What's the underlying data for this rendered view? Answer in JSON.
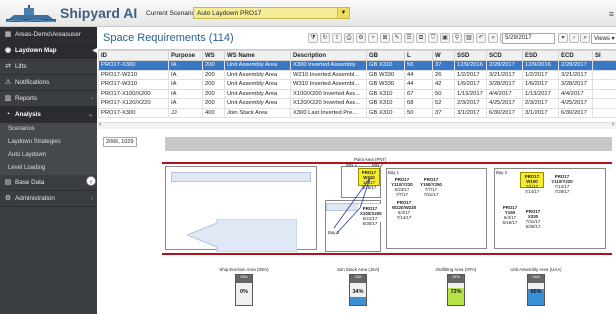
{
  "app": {
    "brand": "Shipyard AI",
    "scenario_label": "Current Scenario:",
    "scenario_value": "Auto Laydown PRO17"
  },
  "sidebar": {
    "top_item": "Areas-Demo\\Areasuser",
    "items": [
      {
        "label": "Laydown Map",
        "icon": "location-pin-icon",
        "active": true
      },
      {
        "label": "Lifts",
        "icon": "swap-arrows-icon"
      },
      {
        "label": "Notifications",
        "icon": "warning-icon"
      },
      {
        "label": "Reports",
        "icon": "bar-chart-icon"
      },
      {
        "label": "Analysis",
        "icon": "pie-chart-icon",
        "active": true
      }
    ],
    "subitems": [
      "Scenarios",
      "Laydown Strategies",
      "Auto Laydown",
      "Level Loading"
    ],
    "bottom_items": [
      {
        "label": "Base Data",
        "icon": "database-icon"
      },
      {
        "label": "Administration",
        "icon": "gear-icon"
      }
    ]
  },
  "header": {
    "title": "Space Requirements (114)",
    "date": "5/29/2017",
    "views": "Views"
  },
  "grid": {
    "columns": [
      "ID",
      "Purpose",
      "WS",
      "WS Name",
      "Description",
      "GB",
      "L",
      "W",
      "SSD",
      "SCD",
      "ESD",
      "ECD",
      "SI"
    ],
    "rows": [
      [
        "PRO17-X300",
        "IA",
        "200",
        "Unit Assembly Area",
        "X300 Inverted Assembly",
        "GB X310",
        "56",
        "37",
        "12/9/2016",
        "2/28/2017",
        "12/9/2016",
        "2/28/2017",
        ""
      ],
      [
        "PRO17-W210",
        "IA",
        "200",
        "Unit Assembly Area",
        "W210 Inverted Assembl...",
        "GB W330",
        "44",
        "26",
        "1/2/2017",
        "3/21/2017",
        "1/2/2017",
        "3/21/2017",
        ""
      ],
      [
        "PRO17-W310",
        "IA",
        "200",
        "Unit Assembly Area",
        "W310 Inverted Assembl...",
        "GB W330",
        "44",
        "42",
        "1/6/2017",
        "3/28/2017",
        "1/6/2017",
        "3/28/2017",
        ""
      ],
      [
        "PRO17-X100/X200",
        "IA",
        "200",
        "Unit Assembly Area",
        "X100/X200 Inverted Ass...",
        "GB X310",
        "67",
        "50",
        "1/13/2017",
        "4/4/2017",
        "1/13/2017",
        "4/4/2017",
        ""
      ],
      [
        "PRO17-X120/X220",
        "IA",
        "200",
        "Unit Assembly Area",
        "X120/X220 Inverted Ass...",
        "GB X310",
        "68",
        "52",
        "2/3/2017",
        "4/25/2017",
        "2/3/2017",
        "4/25/2017",
        ""
      ],
      [
        "PRO17-X300",
        "JJ",
        "400",
        "Join Stack Area",
        "X300 Last Inverted Pre...",
        "GB X310",
        "50",
        "37",
        "3/1/2017",
        "6/30/2017",
        "3/1/2017",
        "6/30/2017",
        ""
      ]
    ]
  },
  "map": {
    "coord": "2066, 1029",
    "paint_area": "Paint Area (PNT)",
    "bay_labels": [
      "Bay 1",
      "Bay 2",
      "Bay 3",
      "Bay 1",
      "Bay 2"
    ],
    "cards": [
      {
        "id": "PRO17 W310",
        "dates": "1/6/17 3/28/17",
        "color": "yellow"
      },
      {
        "id": "PRO17 Y110/Y220",
        "dates": "6/23/17 7/7/17",
        "color": "plain"
      },
      {
        "id": "PRO17 Y150/Y250",
        "dates": "7/7/17 7/21/17",
        "color": "plain"
      },
      {
        "id": "PRO17 W220/W230",
        "dates": "6/4/17 7/14/17",
        "color": "plain"
      },
      {
        "id": "PRO17 X100/X200",
        "dates": "6/21/17 6/30/17",
        "color": "plain"
      },
      {
        "id": "PRO17 W100",
        "dates": "7/1/17 7/14/17",
        "color": "yellow"
      },
      {
        "id": "PRO17 Y110/Y220",
        "dates": "7/14/17 7/28/17",
        "color": "plain"
      },
      {
        "id": "PRO17 Y150",
        "dates": "6/4/17 6/16/17",
        "color": "plain"
      },
      {
        "id": "PRO17 X330",
        "dates": "7/31/17 6/30/17",
        "color": "plain"
      }
    ],
    "areas": [
      {
        "name": "Ship Erection Area (SEA)",
        "code": "SEA",
        "pct_label": "0%",
        "pct": 0,
        "fill": "#4caf50"
      },
      {
        "name": "Join Stack Area (JSA)",
        "code": "JSA",
        "pct_label": "34%",
        "pct": 34,
        "fill": "#3b8fd4"
      },
      {
        "name": "Outfitting Area (OFA)",
        "code": "OFA",
        "pct_label": "72%",
        "pct": 72,
        "fill": "#b5e245"
      },
      {
        "name": "Unit Assembly Area (UAA)",
        "code": "UAA",
        "pct_label": "65%",
        "pct": 65,
        "fill": "#3b8fd4"
      }
    ]
  }
}
